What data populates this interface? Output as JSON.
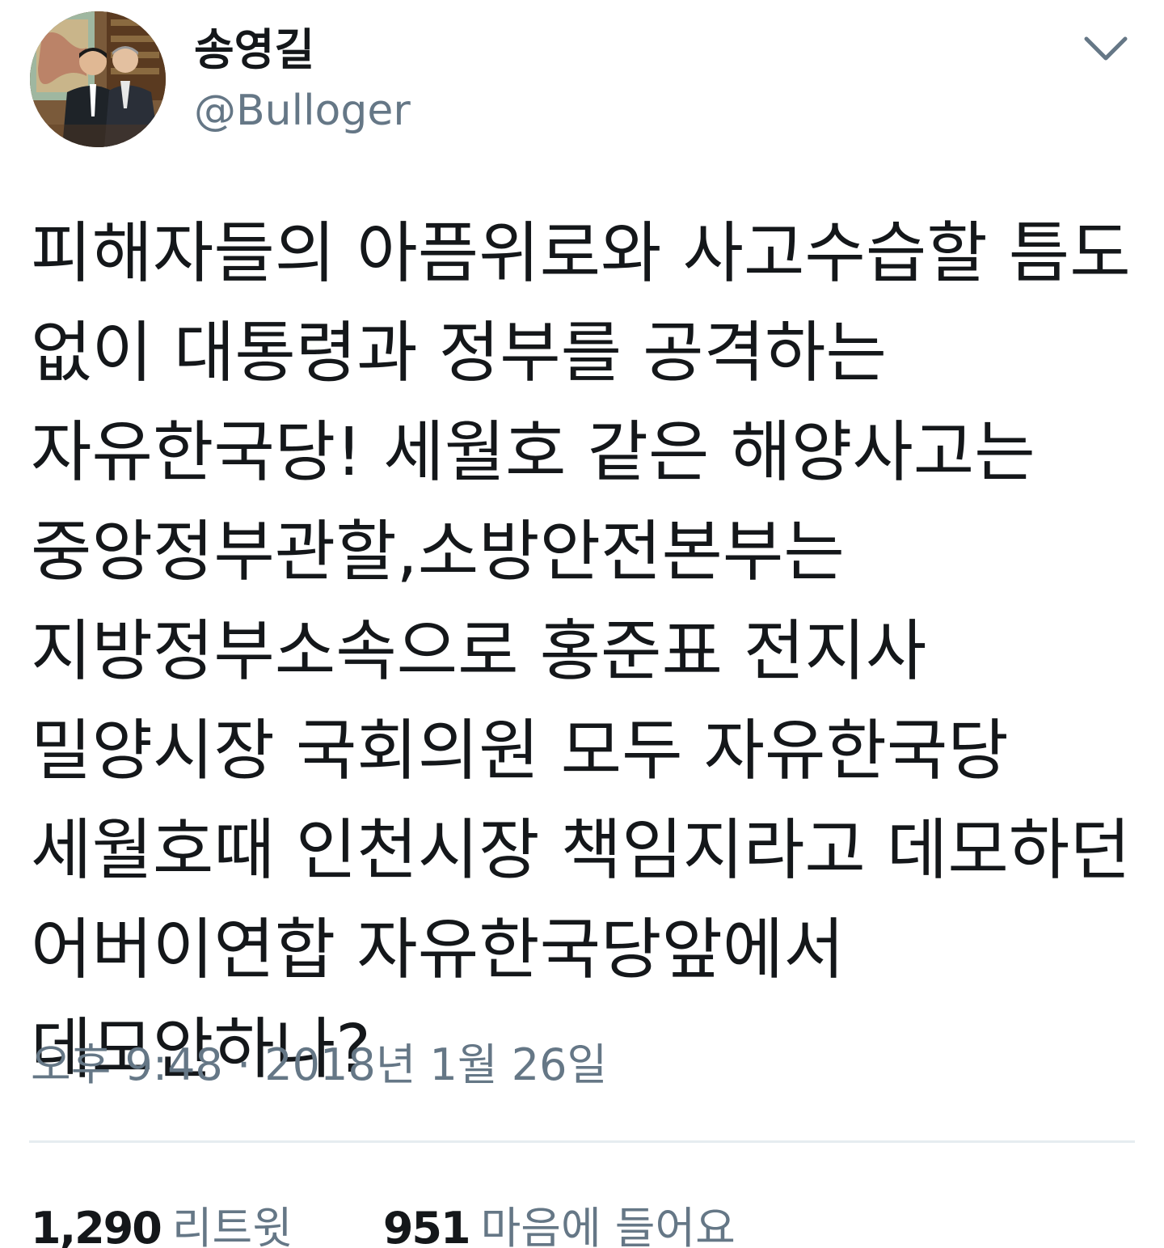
{
  "user": {
    "display_name": "송영길",
    "handle": "@Bulloger"
  },
  "tweet": {
    "text": "피해자들의 아픔위로와 사고수습할 틈도 없이 대통령과 정부를 공격하는 자유한국당! 세월호 같은 해양사고는 중앙정부관할,소방안전본부는 지방정부소속으로 홍준표 전지사 밀양시장 국회의원 모두 자유한국당 세월호때 인천시장 책임지라고 데모하던 어버이연합 자유한국당앞에서 데모안하나?",
    "timestamp": "오후 9:48 · 2018년 1월 26일"
  },
  "stats": {
    "retweets_count": "1,290",
    "retweets_label": "리트윗",
    "likes_count": "951",
    "likes_label": "마음에 들어요"
  },
  "icons": {
    "menu": "chevron-down-icon"
  },
  "colors": {
    "text_primary": "#14171a",
    "text_secondary": "#657786",
    "divider": "#e6ecf0",
    "caret": "#657786"
  }
}
